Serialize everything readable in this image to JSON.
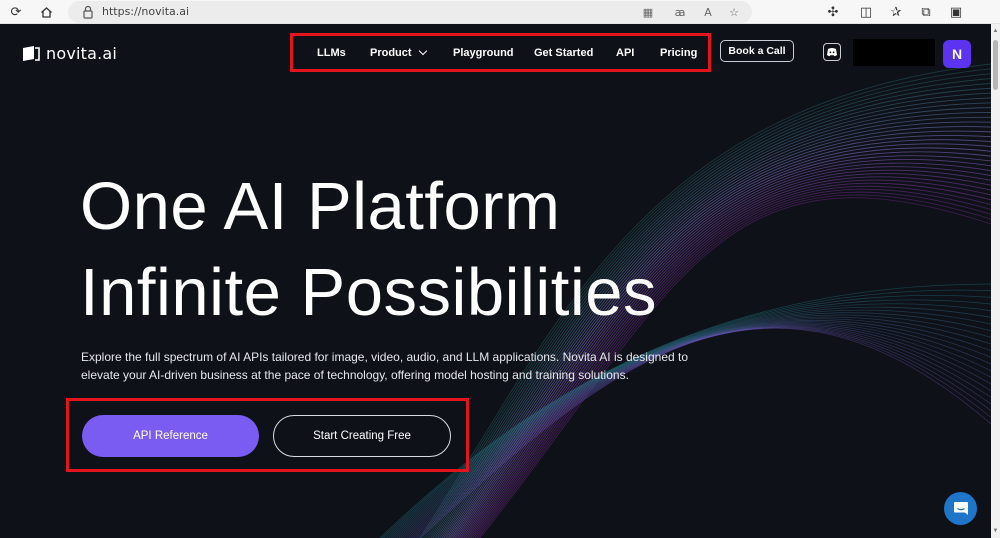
{
  "browser": {
    "url": "https://novita.ai",
    "icons": [
      "reload-icon",
      "home-icon",
      "lock-icon",
      "grid-icon",
      "read-aloud-icon",
      "text-size-icon",
      "favorite-star-icon",
      "extensions-icon",
      "split-screen-icon",
      "favorites-icon",
      "collections-icon",
      "profile-icon"
    ]
  },
  "site": {
    "logo_text": "novita.ai",
    "nav": {
      "llms": "LLMs",
      "product": "Product",
      "playground": "Playground",
      "get_started": "Get Started",
      "api": "API",
      "pricing": "Pricing"
    },
    "book_call": "Book a Call",
    "avatar_initial": "N"
  },
  "hero": {
    "title_line1": "One AI Platform",
    "title_line2": "Infinite Possibilities",
    "description": "Explore the full spectrum of AI APIs tailored for image, video, audio, and LLM applications. Novita AI is designed to elevate your AI-driven business at the pace of technology, offering model hosting and training solutions.",
    "primary_cta": "API Reference",
    "secondary_cta": "Start Creating Free"
  },
  "colors": {
    "background": "#0e1118",
    "primary_button": "#7b5cf2",
    "highlight_box": "#e3141b",
    "avatar": "#5b33f0",
    "chat_bubble": "#1f75c7"
  }
}
